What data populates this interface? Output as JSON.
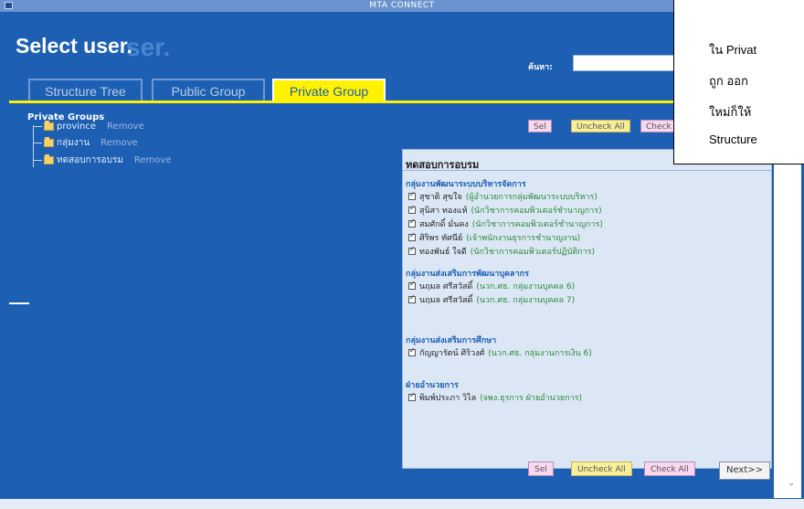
{
  "window": {
    "title": "MTA CONNECT"
  },
  "header": {
    "title": "Select user.",
    "ghost_title": "ser."
  },
  "search": {
    "label": "ค้นหา:",
    "value": ""
  },
  "tabs": [
    {
      "label": "Structure Tree",
      "active": false
    },
    {
      "label": "Public Group",
      "active": false
    },
    {
      "label": "Private Group",
      "active": true
    }
  ],
  "tree": {
    "root": "Private Groups",
    "items": [
      {
        "label": "province",
        "action": "Remove"
      },
      {
        "label": "กลุ่มงาน",
        "action": "Remove"
      },
      {
        "label": "ทดสอบการอบรม",
        "action": "Remove"
      }
    ]
  },
  "toolbar_top": {
    "b1": "Sel",
    "b2": "Uncheck All",
    "b3": "Check"
  },
  "panel": {
    "title": "ทดสอบการอบรม",
    "groups": [
      {
        "name": "กลุ่มงานพัฒนาระบบบริหารจัดการ",
        "members": [
          {
            "name": "สุชาติ สุขใจ",
            "role": "(ผู้อำนวยการกลุ่มพัฒนาระบบบริหาร)"
          },
          {
            "name": "สุนิสา ทองแท้",
            "role": "(นักวิชาการคอมพิวเตอร์ชำนาญการ)"
          },
          {
            "name": "สมศักดิ์ มั่นคง",
            "role": "(นักวิชาการคอมพิวเตอร์ชำนาญการ)"
          },
          {
            "name": "ศิริพร ทัศนีย์",
            "role": "(เจ้าพนักงานธุรการชำนาญงาน)"
          },
          {
            "name": "ทองพันธ์ ใจดี",
            "role": "(นักวิชาการคอมพิวเตอร์ปฏิบัติการ)"
          }
        ]
      },
      {
        "name": "กลุ่มงานส่งเสริมการพัฒนาบุคลากร",
        "members": [
          {
            "name": "นฤมล ศรีสวัสดิ์",
            "role": "(นวก.ศธ. กลุ่มงานบุคคล 6)"
          },
          {
            "name": "นฤมล ศรีสวัสดิ์",
            "role": "(นวก.ศธ. กลุ่มงานบุคคล 7)"
          }
        ]
      },
      {
        "name": "กลุ่มงานส่งเสริมการศึกษา",
        "members": [
          {
            "name": "กัญญารัตน์ ศิริวงศ์",
            "role": "(นวก.ศธ. กลุ่มงานการเงิน 6)"
          }
        ]
      },
      {
        "name": "ฝ่ายอำนวยการ",
        "members": [
          {
            "name": "พิมพ์ประภา วิไล",
            "role": "(จพง.ธุรการ ฝ่ายอำนวยการ)"
          }
        ]
      }
    ]
  },
  "bottom_buttons": {
    "b1": "Sel",
    "b2": "Uncheck All",
    "b3": "Check All",
    "next": "Next>>"
  },
  "tooltip": {
    "line1": "ใน Privat",
    "line2": "ถูก ออก",
    "line3": "ใหม่ก็ให้",
    "line4": "Structure"
  }
}
